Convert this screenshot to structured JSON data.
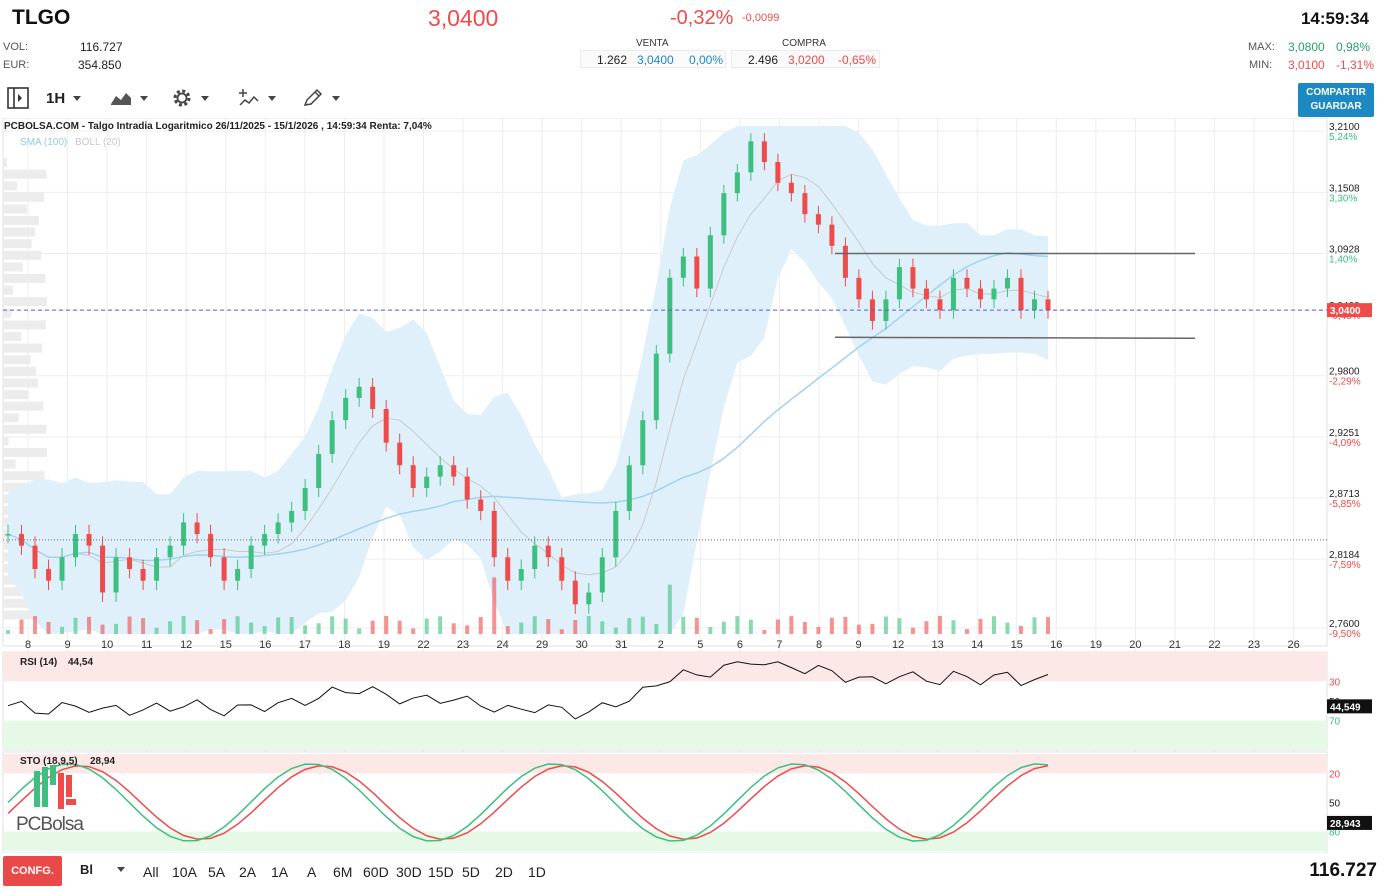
{
  "header": {
    "ticker": "TLGO",
    "price": "3,0400",
    "change_pct": "-0,32%",
    "change_abs": "-0,0099",
    "time": "14:59:34",
    "vol_label": "VOL:",
    "vol_value": "116.727",
    "eur_label": "EUR:",
    "eur_value": "354.850",
    "sell_header": "VENTA",
    "buy_header": "COMPRA",
    "sell_qty": "1.262",
    "sell_price": "3,0400",
    "sell_pct": "0,00%",
    "buy_qty": "2.496",
    "buy_price": "3,0200",
    "buy_pct": "-0,65%",
    "max_label": "MAX:",
    "max_value": "3,0800",
    "max_pct": "0,98%",
    "min_label": "MIN:",
    "min_value": "3,0100",
    "min_pct": "-1,31%"
  },
  "toolbar": {
    "panel_icon": "sidebar-toggle-icon",
    "interval_label": "1H",
    "chart_type_icon": "area-chart-icon",
    "settings_icon": "gear-icon",
    "indicators_icon": "indicators-icon",
    "drawing_icon": "pencil-icon",
    "share_label_1": "COMPARTIR",
    "share_label_2": "GUARDAR"
  },
  "colors": {
    "up": "#3dbf7f",
    "down": "#ee4b4b",
    "band_fill": "#dff0fb",
    "sma": "#9fd3f2",
    "price_line": "#5b5bd6",
    "share_button": "#1d89c2",
    "config_button": "#e84a4a"
  },
  "chart": {
    "title": "PCBOLSA.COM - Talgo Intradia Logaritmico 26/11/2025 - 15/1/2026 , 14:59:34 Renta: 7,04%",
    "legend_sma": "SMA (100)",
    "legend_boll": "BOLL (20)",
    "current_price_label": "3,0400",
    "rsi_label": "RSI (14)",
    "rsi_value": "44,54",
    "rsi_axis_value": "44,549",
    "sto_label": "STO (18,9,5)",
    "sto_value": "28,94",
    "sto_axis_value": "28,943",
    "watermark": "PCBolsa",
    "watermark_icon": "pcbolsa-logo-icon"
  },
  "chart_data": {
    "type": "line",
    "subtype": "candlestick",
    "scale": "log",
    "interval": "1H",
    "ylim": [
      2.755,
      3.215
    ],
    "y_ticks": [
      {
        "price": "3,2100",
        "pct": "5,24%"
      },
      {
        "price": "3,1508",
        "pct": "3,30%"
      },
      {
        "price": "3,0928",
        "pct": "1,40%"
      },
      {
        "price": "3,0400",
        "pct": "-0,48%"
      },
      {
        "price": "2,9800",
        "pct": "-2,29%"
      },
      {
        "price": "2,9251",
        "pct": "-4,09%"
      },
      {
        "price": "2,8713",
        "pct": "-5,85%"
      },
      {
        "price": "2,8184",
        "pct": "-7,59%"
      },
      {
        "price": "2,7600",
        "pct": "-9,50%"
      }
    ],
    "x_labels": [
      "8",
      "9",
      "10",
      "11",
      "12",
      "15",
      "16",
      "17",
      "18",
      "19",
      "22",
      "23",
      "24",
      "29",
      "30",
      "31",
      "2",
      "5",
      "6",
      "7",
      "8",
      "9",
      "12",
      "13",
      "14",
      "15",
      "16",
      "19",
      "20",
      "21",
      "22",
      "23",
      "26"
    ],
    "close_approx": [
      2.84,
      2.83,
      2.81,
      2.8,
      2.82,
      2.84,
      2.83,
      2.79,
      2.82,
      2.81,
      2.8,
      2.82,
      2.83,
      2.85,
      2.84,
      2.82,
      2.8,
      2.81,
      2.83,
      2.84,
      2.85,
      2.86,
      2.88,
      2.91,
      2.94,
      2.96,
      2.97,
      2.95,
      2.92,
      2.9,
      2.88,
      2.89,
      2.9,
      2.89,
      2.87,
      2.86,
      2.82,
      2.8,
      2.81,
      2.83,
      2.82,
      2.8,
      2.78,
      2.79,
      2.82,
      2.86,
      2.9,
      2.94,
      3.0,
      3.07,
      3.09,
      3.06,
      3.11,
      3.15,
      3.17,
      3.2,
      3.18,
      3.16,
      3.15,
      3.13,
      3.12,
      3.1,
      3.07,
      3.05,
      3.03,
      3.05,
      3.08,
      3.06,
      3.05,
      3.04,
      3.07,
      3.06,
      3.05,
      3.06,
      3.07,
      3.04,
      3.05,
      3.04
    ],
    "resistance": 3.0928,
    "support": 3.015,
    "reference_line": 2.835,
    "rsi": {
      "ylim": [
        0,
        100
      ],
      "levels": [
        30,
        50,
        70
      ],
      "last": 44.549
    },
    "sto": {
      "ylim": [
        0,
        100
      ],
      "levels": [
        20,
        50,
        80
      ],
      "last": 28.943
    }
  },
  "rsi_axis": [
    "70",
    "50",
    "30"
  ],
  "sto_axis": [
    "80",
    "50",
    "20"
  ],
  "periods": {
    "scale_label": "Bl",
    "config_label": "CONFG.",
    "items": [
      "All",
      "10A",
      "5A",
      "2A",
      "1A",
      "A",
      "6M",
      "60D",
      "30D",
      "15D",
      "5D",
      "2D",
      "1D"
    ]
  },
  "footer": {
    "volume_total": "116.727"
  }
}
